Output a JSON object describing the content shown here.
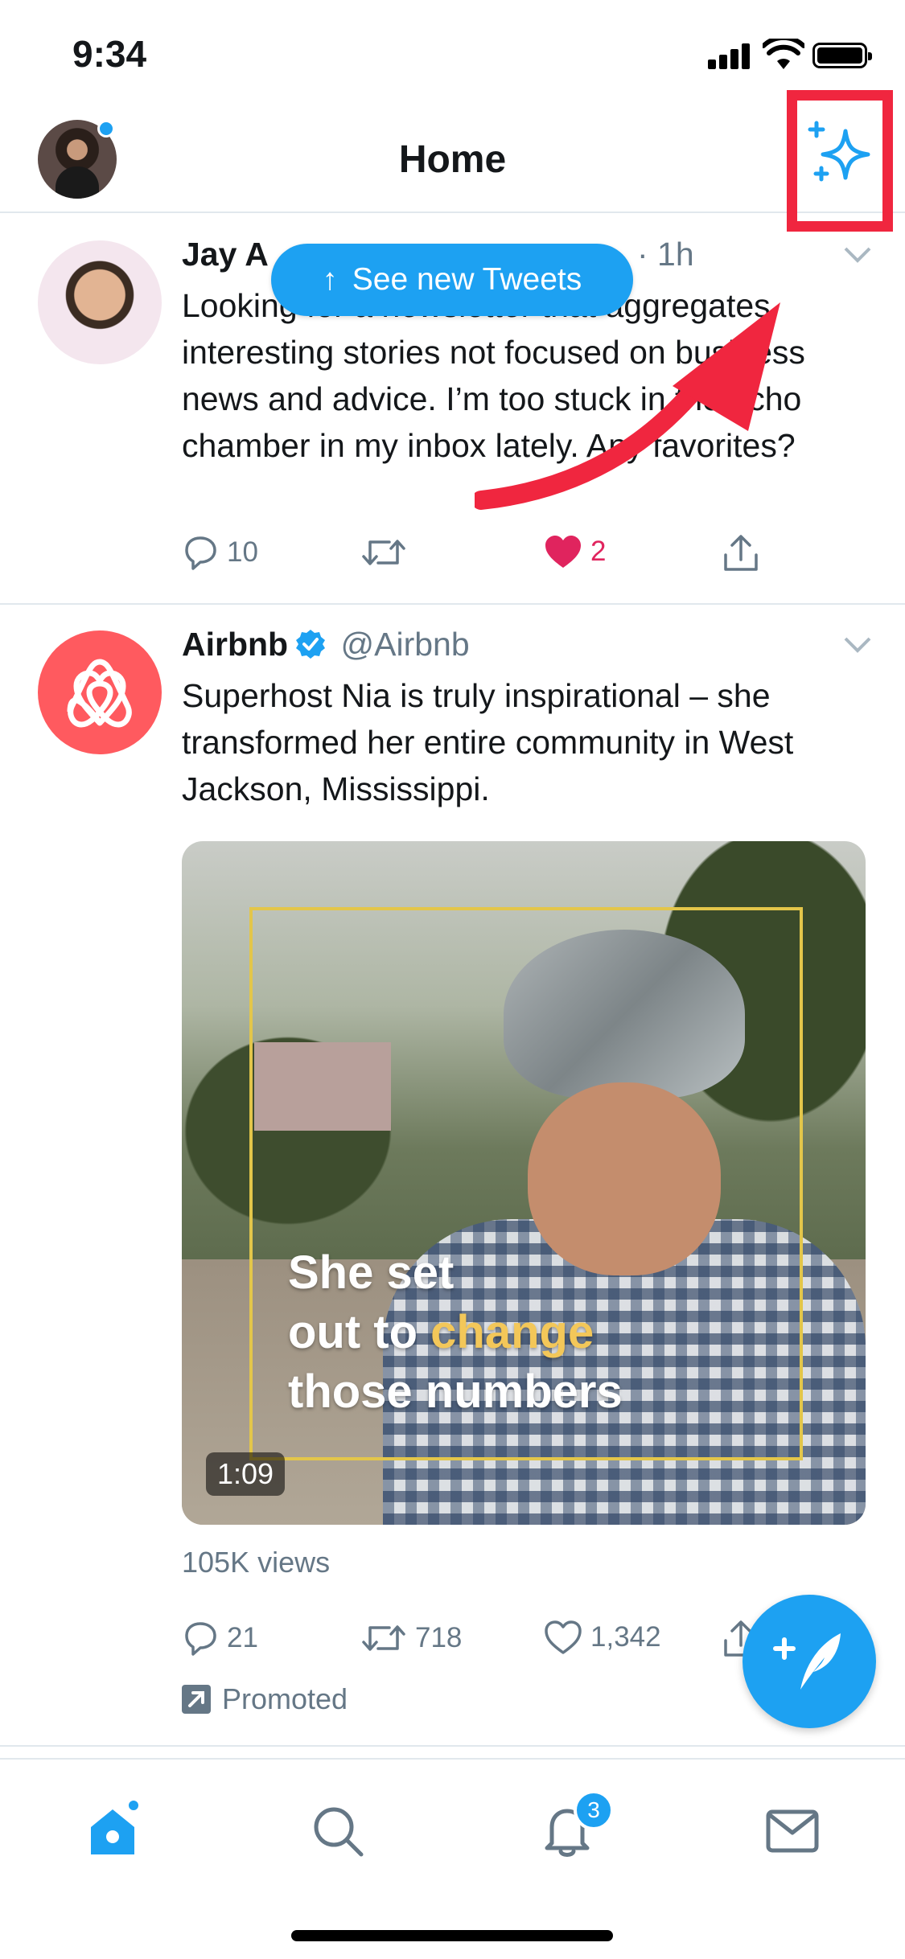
{
  "status_bar": {
    "time": "9:34"
  },
  "header": {
    "title": "Home"
  },
  "new_tweets_pill": {
    "arrow": "↑",
    "label": "See new Tweets"
  },
  "tweets": [
    {
      "name": "Jay A",
      "time": "· 1h",
      "text": "Looking for a newsletter that aggregates interesting stories not focused on business news and advice. I’m too stuck in the echo chamber in my inbox lately. Any favorites?",
      "replies": "10",
      "retweets": "",
      "likes": "2",
      "liked": true
    },
    {
      "name": "Airbnb",
      "handle": "@Airbnb",
      "verified": true,
      "text": "Superhost Nia is truly inspirational – she transformed her entire community in West Jackson, Mississippi.",
      "media": {
        "caption_line1": "She set",
        "caption_line2_prefix": "out to ",
        "caption_line2_highlight": "change",
        "caption_line3": "those numbers",
        "duration": "1:09"
      },
      "views": "105K views",
      "replies": "21",
      "retweets": "718",
      "likes": "1,342",
      "promoted_label": "Promoted"
    }
  ],
  "tab_bar": {
    "items": [
      {
        "name": "home",
        "icon": "home-icon",
        "active": true
      },
      {
        "name": "search",
        "icon": "search-icon"
      },
      {
        "name": "notifications",
        "icon": "bell-icon",
        "badge": "3"
      },
      {
        "name": "messages",
        "icon": "mail-icon"
      }
    ]
  },
  "colors": {
    "accent": "#1da1f2",
    "like": "#e0245e",
    "annotation": "#f0263f",
    "secondary_text": "#657786",
    "airbnb": "#ff5a5f"
  }
}
